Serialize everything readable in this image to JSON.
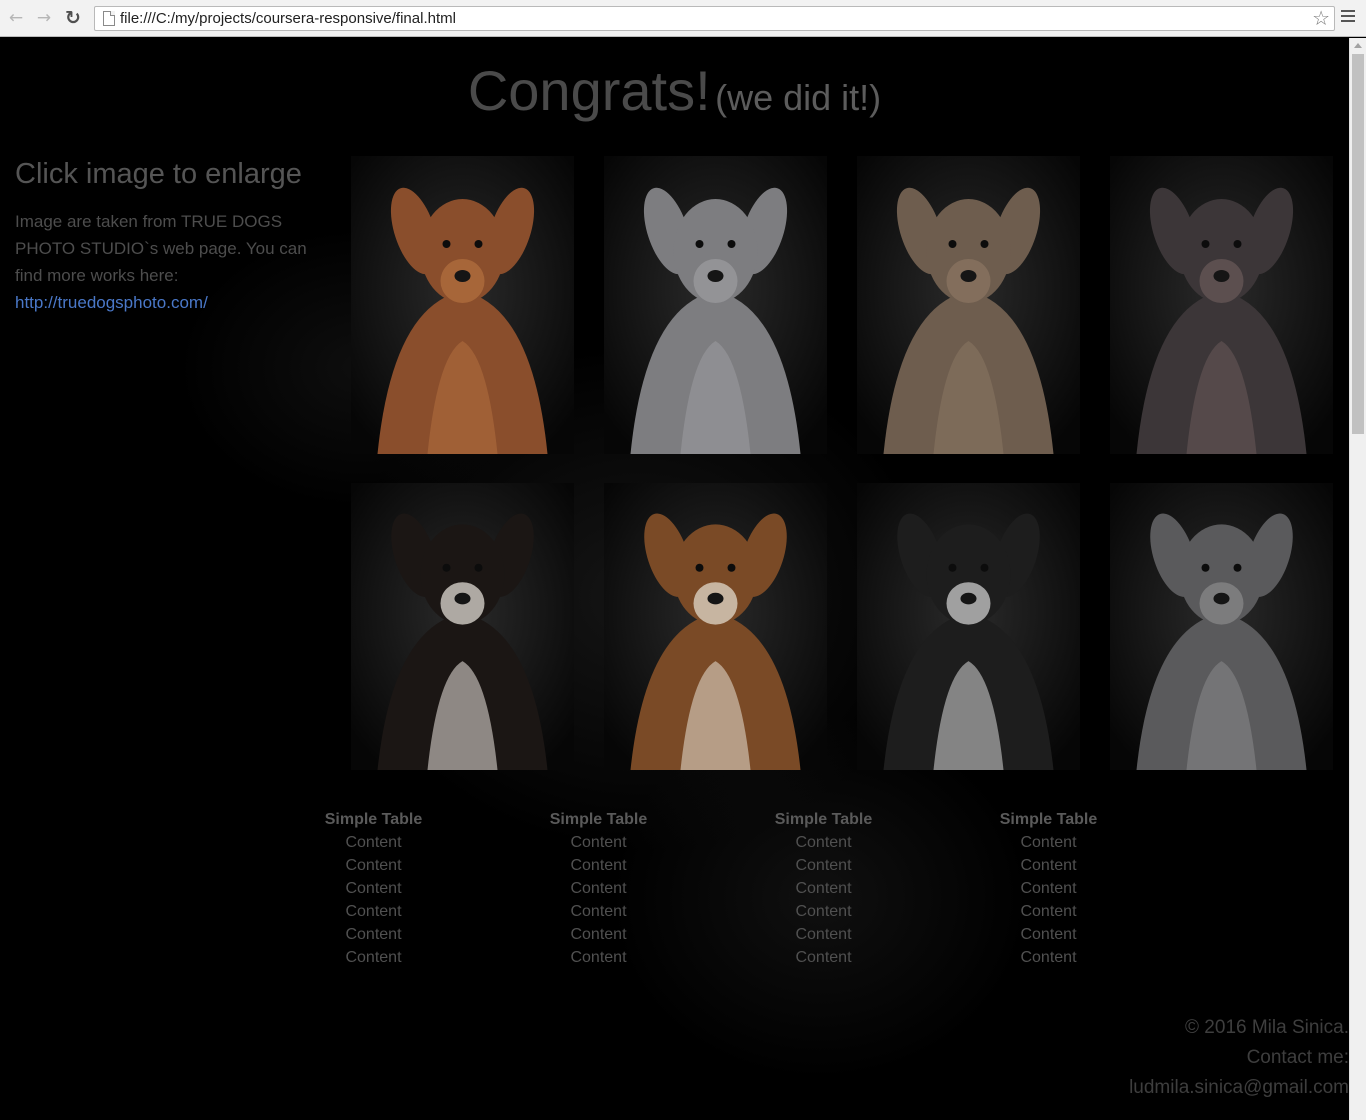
{
  "browser": {
    "url": "file:///C:/my/projects/coursera-responsive/final.html"
  },
  "heading": {
    "title": "Congrats!",
    "subtitle": "(we did it!)"
  },
  "info": {
    "title": "Click image to enlarge",
    "text": "Image are taken from TRUE DOGS PHOTO STUDIO`s web page. You can find more works here:",
    "link": "http://truedogsphoto.com/"
  },
  "gallery": {
    "images": [
      {
        "name": "vizsla",
        "coat": "#8a4e2c",
        "accent": "#b3703f"
      },
      {
        "name": "italian-greyhound",
        "coat": "#7d7d80",
        "accent": "#9c9ca0"
      },
      {
        "name": "french-bulldog",
        "coat": "#6e5d4e",
        "accent": "#8b7662"
      },
      {
        "name": "hairless-dog",
        "coat": "#3c3638",
        "accent": "#6a5a5a"
      },
      {
        "name": "collie-mix",
        "coat": "#1b1614",
        "accent": "#ece8e0"
      },
      {
        "name": "tricolor-sheepdog",
        "coat": "#7a4a26",
        "accent": "#e8e2d6"
      },
      {
        "name": "black-lab-mix",
        "coat": "#1d1d1d",
        "accent": "#d8d8d8"
      },
      {
        "name": "great-dane",
        "coat": "#5a5a5c",
        "accent": "#8a8a8c"
      }
    ]
  },
  "table": {
    "headers": [
      "Simple Table",
      "Simple Table",
      "Simple Table",
      "Simple Table"
    ],
    "rows": [
      [
        "Content",
        "Content",
        "Content",
        "Content"
      ],
      [
        "Content",
        "Content",
        "Content",
        "Content"
      ],
      [
        "Content",
        "Content",
        "Content",
        "Content"
      ],
      [
        "Content",
        "Content",
        "Content",
        "Content"
      ],
      [
        "Content",
        "Content",
        "Content",
        "Content"
      ],
      [
        "Content",
        "Content",
        "Content",
        "Content"
      ]
    ]
  },
  "footer": {
    "copyright": "© 2016 Mila Sinica.",
    "contact_label": "Contact me:",
    "email": "ludmila.sinica@gmail.com"
  }
}
